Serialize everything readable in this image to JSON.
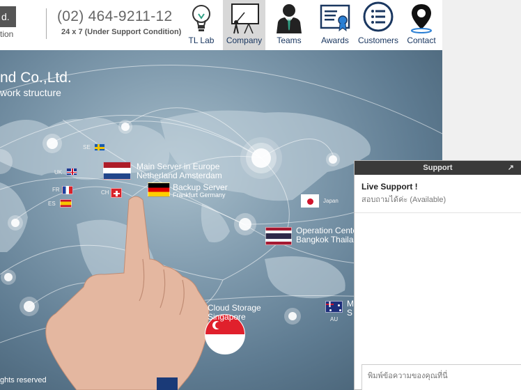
{
  "header": {
    "logo_text": "d.",
    "logo_sub": "tion",
    "phone": "(02) 464-9211-12",
    "phone_sub": "24 x 7 (Under Support Condition)",
    "nav": [
      {
        "label": "TL Lab",
        "icon": "lightbulb-icon"
      },
      {
        "label": "Company",
        "icon": "presentation-board-icon"
      },
      {
        "label": "Teams",
        "icon": "businessman-icon"
      },
      {
        "label": "Awards",
        "icon": "certificate-icon"
      },
      {
        "label": "Customers",
        "icon": "list-icon"
      },
      {
        "label": "Contact",
        "icon": "map-pin-icon"
      }
    ],
    "active_nav": "Company"
  },
  "hero": {
    "title": "nd Co.,Ltd.",
    "subtitle": "work structure",
    "footer": "ghts reserved",
    "locations": [
      {
        "code": "SE",
        "country": "Sweden"
      },
      {
        "code": "UK",
        "country": "United Kingdom"
      },
      {
        "code": "FR",
        "country": "France"
      },
      {
        "code": "ES",
        "country": "Spain"
      },
      {
        "code": "CH",
        "country": "Switzerland"
      },
      {
        "label": "Japan"
      },
      {
        "label_1": "Main Server in Europe",
        "label_2": "Netherland Amsterdam"
      },
      {
        "label_1": "Backup Server",
        "label_2": "Frankfurt Germany"
      },
      {
        "label_1": "Operation Center",
        "label_2": "Bangkok Thailand"
      },
      {
        "label_1": "Cloud Storage",
        "label_2": "Singapore"
      },
      {
        "code": "AU",
        "label_1": "M",
        "label_2": "S"
      }
    ]
  },
  "support": {
    "header": "Support",
    "title": "Live Support !",
    "status": "สอบถามได้ค่ะ (Available)",
    "input_placeholder": "พิมพ์ข้อความของคุณที่นี่"
  },
  "colors": {
    "nav_text": "#1a3760",
    "active_nav_bg": "#d8d8d8",
    "support_header_bg": "#3a3a3a"
  }
}
